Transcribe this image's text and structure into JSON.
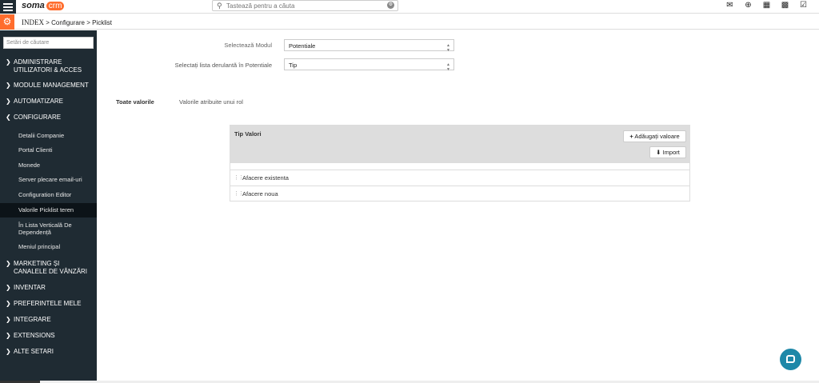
{
  "header": {
    "logo_text": "soma",
    "logo_badge": "crm",
    "search_placeholder": "Tastează pentru a căuta",
    "icons": [
      "mail-icon",
      "plus-circle-icon",
      "calendar-icon",
      "bar-chart-icon",
      "checkbox-icon"
    ]
  },
  "breadcrumb": {
    "index": "INDEX",
    "sep1": ">",
    "item1": "Configurare",
    "sep2": ">",
    "item2": "Picklist"
  },
  "sidebar": {
    "search_placeholder": "Setări de căutare",
    "sections": [
      {
        "label": "ADMINISTRARE UTILIZATORI & ACCES",
        "expanded": false
      },
      {
        "label": "MODULE MANAGEMENT",
        "expanded": false
      },
      {
        "label": "AUTOMATIZARE",
        "expanded": false
      },
      {
        "label": "CONFIGURARE",
        "expanded": true
      },
      {
        "label": "MARKETING ȘI CANALELE DE VÂNZĂRI",
        "expanded": false
      },
      {
        "label": "INVENTAR",
        "expanded": false
      },
      {
        "label": "PREFERINTELE MELE",
        "expanded": false
      },
      {
        "label": "INTEGRARE",
        "expanded": false
      },
      {
        "label": "EXTENSIONS",
        "expanded": false
      },
      {
        "label": "ALTE SETARI",
        "expanded": false
      }
    ],
    "config_items": [
      "Detalii Companie",
      "Portal Clienti",
      "Monede",
      "Server plecare email-uri",
      "Configuration Editor",
      "Valorile Picklist teren",
      "În Lista Verticală De Dependență",
      "Meniul principal"
    ],
    "active_item": "Valorile Picklist teren"
  },
  "form": {
    "module_label": "Selectează Modul",
    "module_value": "Potentiale",
    "picklist_label": "Selectați lista derulantă în Potentiale",
    "picklist_value": "Tip"
  },
  "tabs": {
    "all_values": "Toate valorile",
    "role_values": "Valorile atribuite unui rol"
  },
  "panel": {
    "title": "Tip Valori",
    "add_button": "Adăugați valoare",
    "import_button": "Import",
    "values": [
      "Afacere existenta",
      "Afacere noua"
    ]
  },
  "colors": {
    "sidebar_bg": "#1f2b33",
    "accent": "#ff6d2d",
    "chat": "#1e88a8"
  }
}
